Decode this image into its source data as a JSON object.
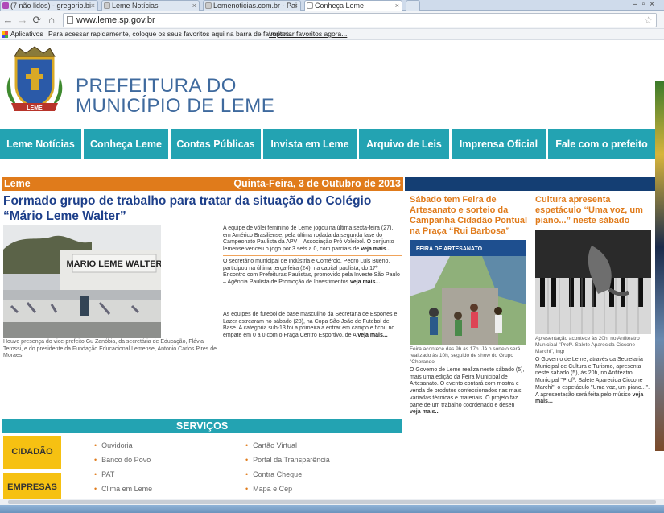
{
  "browser": {
    "tabs": [
      {
        "label": "(7 não lidos) - gregorio.bi",
        "active": false
      },
      {
        "label": "Leme Notícias",
        "active": false
      },
      {
        "label": "Lemenoticias.com.br - Pai",
        "active": false
      },
      {
        "label": "Conheça Leme",
        "active": true
      }
    ],
    "url": "www.leme.sp.gov.br",
    "bookmarks": {
      "apps_label": "Aplicativos",
      "hint": "Para acessar rapidamente, coloque os seus favoritos aqui na barra de favoritos.",
      "import_link": "Importar favoritos agora..."
    }
  },
  "header": {
    "title_line1": "PREFEITURA DO",
    "title_line2": "MUNICÍPIO DE LEME",
    "logo_text": "LEME"
  },
  "nav": [
    {
      "label": "Leme Notícias"
    },
    {
      "label": "Conheça Leme"
    },
    {
      "label": "Contas Públicas"
    },
    {
      "label": "Invista em Leme"
    },
    {
      "label": "Arquivo de Leis"
    },
    {
      "label": "Imprensa Oficial"
    },
    {
      "label": "Fale com o prefeito"
    }
  ],
  "news": {
    "city": "Leme",
    "date": "Quinta-Feira, 3 de Outubro de 2013",
    "headline": "Formado grupo de trabalho para tratar da situação do Colégio “Mário Leme Walter”",
    "photo_caption": "Houve presença do vice-prefeito Gu Zanóbia, da secretária de Educação, Flávia Terossi, e do presidente da Fundação Educacional Lemense, Antonio Carlos Pires de Moraes",
    "school_sign": "MARIO LEME WALTER",
    "briefs": [
      {
        "text": "A equipe de vôlei feminino de Leme jogou na última sexta-feira (27), em Américo Brasiliense, pela última rodada da segunda fase do Campeonato Paulista da APV – Associação Pró Voleibol. O conjunto lemense venceu o jogo por 3 sets a 0, com parciais de",
        "more": "veja mais..."
      },
      {
        "text": "O secretário municipal de Indústria e Comércio, Pedro Luis Bueno, participou na última terça-feira (24), na capital paulista, do 17º Encontro com Prefeituras Paulistas, promovido pela Investe São Paulo – Agência Paulista de Promoção de Investimentos",
        "more": "veja mais..."
      },
      {
        "text": "As equipes de futebol de base masculino da Secretaria de Esportes e Lazer estrearam no sábado (28), na Copa São João de Futebol de Base. A categoria sub-13 foi a primeira a entrar em campo e ficou no empate em 0 a 0 com o Fraga Centro Esportivo, de A",
        "more": "veja mais..."
      }
    ],
    "col1": {
      "title": "Sábado tem Feira de Artesanato e sorteio da Campanha Cidadão Pontual na Praça “Rui Barbosa”",
      "banner": "FEIRA DE ARTESANATO",
      "caption": "Feira acontece das 9h às 17h. Já o sorteio será realizado às 10h, seguido de show do Grupo \"Chorando",
      "body": "O Governo de Leme realiza neste sábado (5), mais uma edição da Feira Municipal de Artesanato. O evento contará com mostra e venda de produtos confeccionados nas mais variadas técnicas e materiais. O projeto faz parte de um trabalho coordenado e desen",
      "more": "veja mais..."
    },
    "col2": {
      "title": "Cultura apresenta espetáculo “Uma voz, um piano...” neste sábado",
      "caption": "Apresentação acontece às 20h, no Anfiteatro Municipal \"Profª. Salete Aparecida Ciccone Marchi\", Ingr",
      "body": "O Governo de Leme, através da Secretaria Municipal de Cultura e Turismo, apresenta neste sábado (5), às 20h, no Anfiteatro Municipal \"Profª. Salete Aparecida Ciccone Marchi\", o espetáculo \"Uma voz, um piano...\". A apresentação será feita pelo músico",
      "more": "veja mais..."
    }
  },
  "services": {
    "title": "SERVIÇOS",
    "boxes": [
      "CIDADÃO",
      "EMPRESAS"
    ],
    "links_col1": [
      "Ouvidoria",
      "Banco do Povo",
      "PAT",
      "Clima em Leme"
    ],
    "links_col2": [
      "Cartão Virtual",
      "Portal da Transparência",
      "Contra Cheque",
      "Mapa e Cep"
    ]
  },
  "colors": {
    "teal": "#23a3b2",
    "orange": "#e07b1b",
    "navy": "#143e73",
    "headline_blue": "#1d3f8a",
    "gold": "#f6c112"
  }
}
